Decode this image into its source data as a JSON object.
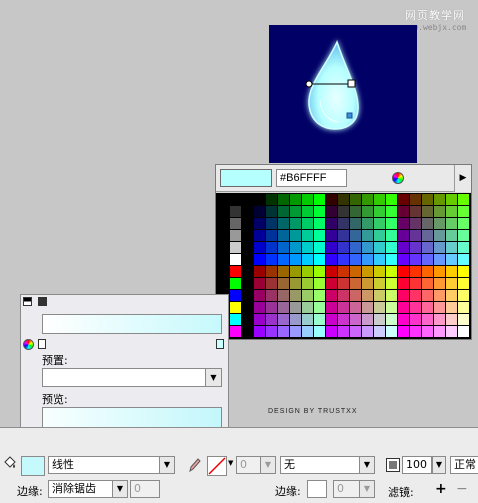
{
  "watermark": {
    "line1": "网页教学网",
    "line2": "www.webjx.com"
  },
  "swatches": {
    "hex_value": "#B6FFFF",
    "current_color": "#B6FFFF",
    "more_arrow": "▶"
  },
  "gradient_panel": {
    "preset_label": "预置:",
    "preset_value": "",
    "preview_label": "预览:",
    "left_stop_color": "#FFFFFF",
    "right_stop_color": "#C6F9FC"
  },
  "credit": "DESIGN BY TRUSTXX",
  "toolbar": {
    "fill_type": "线性",
    "stroke_value": "0",
    "stroke_style": "无",
    "edge_label": "边缘:",
    "edge_value": "消除锯齿",
    "edge_num": "0",
    "edge2_label": "边缘:",
    "edge2_value": "0",
    "opacity": "100",
    "blend_mode": "正常",
    "filter_label": "滤镜:",
    "add_filter": "+",
    "remove_filter": "−"
  }
}
